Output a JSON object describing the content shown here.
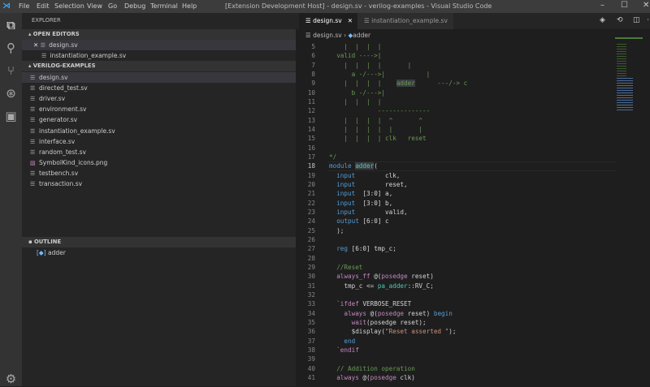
{
  "titlebar": {
    "menu": [
      "File",
      "Edit",
      "Selection",
      "View",
      "Go",
      "Debug",
      "Terminal",
      "Help"
    ],
    "title": "[Extension Development Host] - design.sv - verilog-examples - Visual Studio Code"
  },
  "sidebar": {
    "header": "EXPLORER",
    "open_editors": {
      "label": "OPEN EDITORS",
      "items": [
        "design.sv",
        "instantiation_example.sv"
      ]
    },
    "folder": {
      "label": "VERILOG-EXAMPLES",
      "files": [
        "design.sv",
        "directed_test.sv",
        "driver.sv",
        "environment.sv",
        "generator.sv",
        "instantiation_example.sv",
        "interface.sv",
        "random_test.sv",
        "SymbolKind_icons.png",
        "testbench.sv",
        "transaction.sv"
      ]
    },
    "outline": {
      "label": "OUTLINE",
      "items": [
        "adder"
      ]
    }
  },
  "editor": {
    "tabs": [
      "design.sv",
      "instantiation_example.sv"
    ],
    "breadcrumb": [
      "design.sv",
      "adder"
    ],
    "first_line": 5,
    "current_line": 18,
    "lines": [
      [
        [
          "    |  |  |  |",
          "c"
        ]
      ],
      [
        [
          "  valid ---->|",
          "c"
        ]
      ],
      [
        [
          "    |  |  |  |       |",
          "c"
        ]
      ],
      [
        [
          "      a -/--->|           |",
          "c"
        ]
      ],
      [
        [
          "    |  |  |  |    ",
          "c"
        ],
        [
          "adder",
          "hlc"
        ],
        [
          "      ---/-> c",
          "c"
        ]
      ],
      [
        [
          "      b -/--->|",
          "c"
        ]
      ],
      [
        [
          "    |  |  |  |",
          "c"
        ]
      ],
      [
        [
          "             --------------",
          "c"
        ]
      ],
      [
        [
          "    |  |  |  |  ^       ^",
          "c"
        ]
      ],
      [
        [
          "    |  |  |  |  |       |",
          "c"
        ]
      ],
      [
        [
          "    |  |  |  | clk   reset",
          "c"
        ]
      ],
      [
        [
          "",
          "c"
        ]
      ],
      [
        [
          "*/",
          "c"
        ]
      ],
      [
        [
          "module ",
          "k"
        ],
        [
          "adder",
          "hl"
        ],
        [
          "(",
          "t"
        ]
      ],
      [
        [
          "  input",
          "k"
        ],
        [
          "        clk,",
          "t"
        ]
      ],
      [
        [
          "  input",
          "k"
        ],
        [
          "        reset,",
          "t"
        ]
      ],
      [
        [
          "  input",
          "k"
        ],
        [
          "  [3:0] a,",
          "t"
        ]
      ],
      [
        [
          "  input",
          "k"
        ],
        [
          "  [3:0] b,",
          "t"
        ]
      ],
      [
        [
          "  input",
          "k"
        ],
        [
          "        valid,",
          "t"
        ]
      ],
      [
        [
          "  output",
          "k"
        ],
        [
          " [6:0] c",
          "t"
        ]
      ],
      [
        [
          "  );",
          "t"
        ]
      ],
      [
        [
          "",
          "t"
        ]
      ],
      [
        [
          "  reg",
          "k"
        ],
        [
          " [6:0] tmp_c;",
          "t"
        ]
      ],
      [
        [
          "",
          "t"
        ]
      ],
      [
        [
          "  //Reset",
          "c"
        ]
      ],
      [
        [
          "  always_ff",
          "p"
        ],
        [
          " @(",
          "t"
        ],
        [
          "posedge",
          "p"
        ],
        [
          " reset)",
          "t"
        ]
      ],
      [
        [
          "    tmp_c <= ",
          "t"
        ],
        [
          "pa_adder",
          "ty"
        ],
        [
          "::RV_C;",
          "t"
        ]
      ],
      [
        [
          "",
          "t"
        ]
      ],
      [
        [
          "  `ifdef",
          "p"
        ],
        [
          " VERBOSE_RESET",
          "t"
        ]
      ],
      [
        [
          "    always",
          "p"
        ],
        [
          " @(",
          "t"
        ],
        [
          "posedge",
          "p"
        ],
        [
          " reset) ",
          "t"
        ],
        [
          "begin",
          "k"
        ]
      ],
      [
        [
          "      wait",
          "p"
        ],
        [
          "(posedge reset);",
          "t"
        ]
      ],
      [
        [
          "      $display(",
          "t"
        ],
        [
          "\"Reset asserted \"",
          "s"
        ],
        [
          ");",
          "t"
        ]
      ],
      [
        [
          "    end",
          "k"
        ]
      ],
      [
        [
          "  `endif",
          "p"
        ]
      ],
      [
        [
          "",
          "t"
        ]
      ],
      [
        [
          "  // Addition operation",
          "c"
        ]
      ],
      [
        [
          "  always",
          "p"
        ],
        [
          " @(",
          "t"
        ],
        [
          "posedge",
          "p"
        ],
        [
          " clk)",
          "t"
        ]
      ]
    ]
  }
}
